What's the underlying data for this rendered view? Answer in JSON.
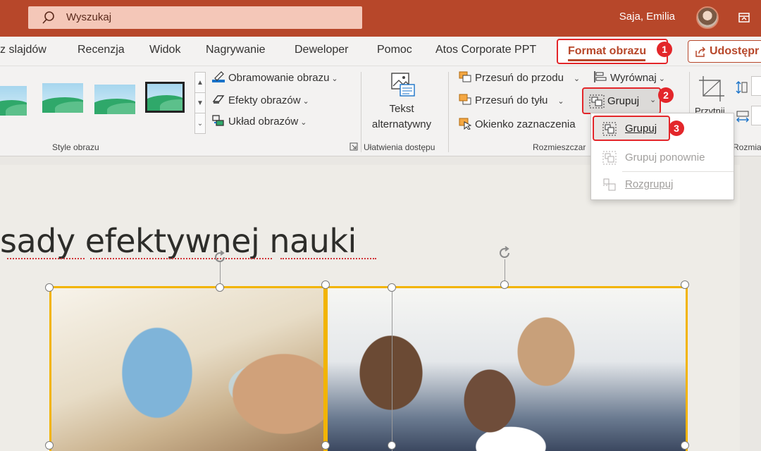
{
  "titlebar": {
    "search_placeholder": "Wyszukaj",
    "user_name": "Saja, Emilia"
  },
  "tabs": [
    {
      "label": "z slajdów"
    },
    {
      "label": "Recenzja"
    },
    {
      "label": "Widok"
    },
    {
      "label": "Nagrywanie"
    },
    {
      "label": "Deweloper"
    },
    {
      "label": "Pomoc"
    },
    {
      "label": "Atos Corporate PPT"
    },
    {
      "label": "Format obrazu",
      "active": true
    }
  ],
  "share_label": "Udostępr",
  "ribbon": {
    "picture_styles": {
      "group_label": "Style obrazu",
      "border": "Obramowanie obrazu",
      "effects": "Efekty obrazów",
      "layout": "Układ obrazów"
    },
    "accessibility": {
      "group_label": "Ułatwienia dostępu",
      "alt_text_line1": "Tekst",
      "alt_text_line2": "alternatywny"
    },
    "arrange": {
      "group_label": "Rozmieszczar",
      "bring_forward": "Przesuń do przodu",
      "send_backward": "Przesuń do tyłu",
      "selection_pane": "Okienko zaznaczenia",
      "align": "Wyrównaj",
      "group": "Grupuj"
    },
    "size": {
      "group_label": "Rozmia",
      "crop": "Przytnij"
    }
  },
  "group_menu": {
    "items": [
      {
        "label": "Grupuj",
        "enabled": true
      },
      {
        "label": "Grupuj ponownie",
        "enabled": false
      },
      {
        "label": "Rozgrupuj",
        "enabled": false
      }
    ]
  },
  "steps": [
    "1",
    "2",
    "3"
  ],
  "slide": {
    "title": "sady efektywnej nauki"
  },
  "colors": {
    "accent": "#b7472a",
    "highlight_red": "#e3262a",
    "selection": "#f2b400"
  }
}
